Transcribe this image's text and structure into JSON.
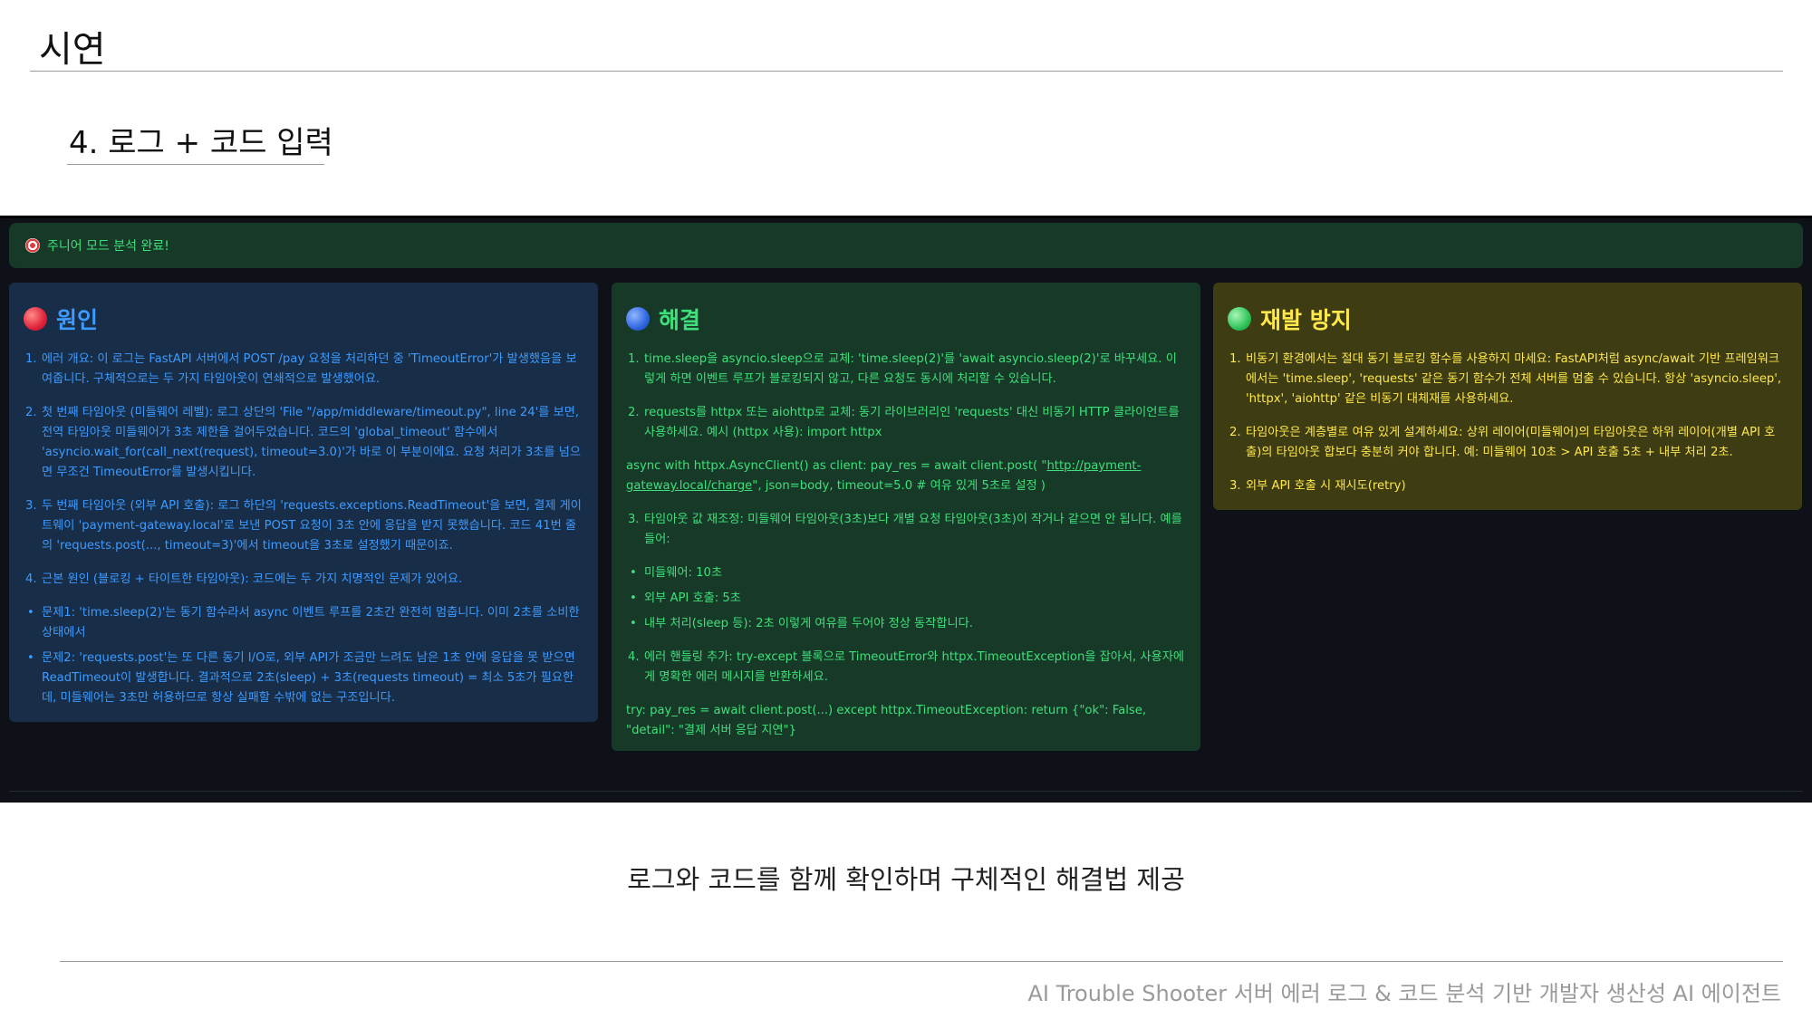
{
  "slide": {
    "title": "시연",
    "section_heading": "4. 로그 + 코드 입력",
    "caption": "로그와 코드를 함께 확인하며 구체적인 해결법 제공",
    "footer": "AI Trouble Shooter 서버 에러 로그 & 코드 분석 기반 개발자 생산성 AI 에이전트"
  },
  "app": {
    "banner": {
      "icon": "target-icon",
      "text": "주니어 모드 분석 완료!"
    },
    "cause": {
      "title": "원인",
      "items": [
        {
          "marker": "1.",
          "text": "에러 개요: 이 로그는 FastAPI 서버에서 POST /pay 요청을 처리하던 중 'TimeoutError'가 발생했음을 보여줍니다. 구체적으로는 두 가지 타임아웃이 연쇄적으로 발생했어요."
        },
        {
          "marker": "2.",
          "text": "첫 번째 타임아웃 (미들웨어 레벨): 로그 상단의 'File \"/app/middleware/timeout.py\", line 24'를 보면, 전역 타임아웃 미들웨어가 3초 제한을 걸어두었습니다. 코드의 'global_timeout' 함수에서 'asyncio.wait_for(call_next(request), timeout=3.0)'가 바로 이 부분이에요. 요청 처리가 3초를 넘으면 무조건 TimeoutError를 발생시킵니다."
        },
        {
          "marker": "3.",
          "text": "두 번째 타임아웃 (외부 API 호출): 로그 하단의 'requests.exceptions.ReadTimeout'을 보면, 결제 게이트웨이 'payment-gateway.local'로 보낸 POST 요청이 3초 안에 응답을 받지 못했습니다. 코드 41번 줄의 'requests.post(..., timeout=3)'에서 timeout을 3초로 설정했기 때문이죠."
        },
        {
          "marker": "4.",
          "text": "근본 원인 (블로킹 + 타이트한 타임아웃): 코드에는 두 가지 치명적인 문제가 있어요."
        }
      ],
      "bullets": [
        {
          "marker": "•",
          "text": "문제1: 'time.sleep(2)'는 동기 함수라서 async 이벤트 루프를 2초간 완전히 멈춥니다. 이미 2초를 소비한 상태에서"
        },
        {
          "marker": "•",
          "text": "문제2: 'requests.post'는 또 다른 동기 I/O로, 외부 API가 조금만 느려도 남은 1초 안에 응답을 못 받으면 ReadTimeout이 발생합니다. 결과적으로 2초(sleep) + 3초(requests timeout) = 최소 5초가 필요한데, 미들웨어는 3초만 허용하므로 항상 실패할 수밖에 없는 구조입니다."
        }
      ]
    },
    "solution": {
      "title": "해결",
      "item1": {
        "marker": "1.",
        "text": "time.sleep을 asyncio.sleep으로 교체: 'time.sleep(2)'를 'await asyncio.sleep(2)'로 바꾸세요. 이렇게 하면 이벤트 루프가 블로킹되지 않고, 다른 요청도 동시에 처리할 수 있습니다."
      },
      "item2": {
        "marker": "2.",
        "text": "requests를 httpx 또는 aiohttp로 교체: 동기 라이브러리인 'requests' 대신 비동기 HTTP 클라이언트를 사용하세요. 예시 (httpx 사용): import httpx"
      },
      "code1": {
        "before": "async with httpx.AsyncClient() as client: pay_res = await client.post( \"",
        "link": "http://payment-gateway.local/charge",
        "after": "\", json=body, timeout=5.0 # 여유 있게 5초로 설정 )"
      },
      "item3": {
        "marker": "3.",
        "text": "타임아웃 값 재조정: 미들웨어 타임아웃(3초)보다 개별 요청 타임아웃(3초)이 작거나 같으면 안 됩니다. 예를 들어:"
      },
      "bullets": [
        {
          "marker": "•",
          "text": "미들웨어: 10초"
        },
        {
          "marker": "•",
          "text": "외부 API 호출: 5초"
        },
        {
          "marker": "•",
          "text": "내부 처리(sleep 등): 2초 이렇게 여유를 두어야 정상 동작합니다."
        }
      ],
      "item4": {
        "marker": "4.",
        "text": "에러 핸들링 추가: try-except 블록으로 TimeoutError와 httpx.TimeoutException을 잡아서, 사용자에게 명확한 에러 메시지를 반환하세요."
      },
      "code2": "try: pay_res = await client.post(...) except httpx.TimeoutException: return {\"ok\": False, \"detail\": \"결제 서버 응답 지연\"}"
    },
    "prevention": {
      "title": "재발 방지",
      "items": [
        {
          "marker": "1.",
          "text": "비동기 환경에서는 절대 동기 블로킹 함수를 사용하지 마세요: FastAPI처럼 async/await 기반 프레임워크에서는 'time.sleep', 'requests' 같은 동기 함수가 전체 서버를 멈출 수 있습니다. 항상 'asyncio.sleep', 'httpx', 'aiohttp' 같은 비동기 대체재를 사용하세요."
        },
        {
          "marker": "2.",
          "text": "타임아웃은 계층별로 여유 있게 설계하세요: 상위 레이어(미들웨어)의 타임아웃은 하위 레이어(개별 API 호출)의 타임아웃 합보다 충분히 커야 합니다. 예: 미들웨어 10초 > API 호출 5초 + 내부 처리 2초."
        },
        {
          "marker": "3.",
          "text": "외부 API 호출 시 재시도(retry)"
        }
      ]
    },
    "colors": {
      "background": "#0e1117",
      "cause_text": "#3d9bff",
      "solution_text": "#3de07a",
      "prevention_text": "#ffe84a"
    }
  }
}
